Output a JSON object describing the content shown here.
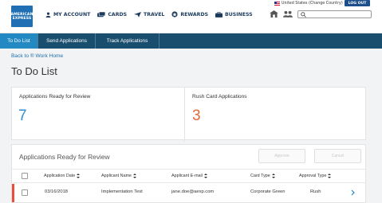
{
  "header": {
    "logo_lines": [
      "AMERICAN",
      "EXPRESS"
    ],
    "nav": [
      {
        "label": "MY ACCOUNT",
        "icon": "person-icon"
      },
      {
        "label": "CARDS",
        "icon": "cards-icon"
      },
      {
        "label": "TRAVEL",
        "icon": "plane-icon"
      },
      {
        "label": "REWARDS",
        "icon": "rewards-icon"
      },
      {
        "label": "BUSINESS",
        "icon": "briefcase-icon"
      }
    ],
    "country": "United States (Change Country)",
    "logout_label": "LOG OUT",
    "search_placeholder": ""
  },
  "tabs": [
    {
      "label": "To Do List",
      "active": true
    },
    {
      "label": "Send Applications",
      "active": false
    },
    {
      "label": "Track Applications",
      "active": false
    }
  ],
  "breadcrumb": "Back to ® Work Home",
  "page_title": "To Do List",
  "stats": [
    {
      "label": "Applications Ready for Review",
      "value": "7"
    },
    {
      "label": "Rush Card Applications",
      "value": "3"
    }
  ],
  "review": {
    "title": "Applications Ready for Review",
    "approve_label": "Approve",
    "cancel_label": "Cancel",
    "columns": [
      "Application Date",
      "Applicant Name",
      "Applicant E-mail",
      "Card Type",
      "Approval Type"
    ],
    "rows": [
      {
        "date": "03/16/2018",
        "name": "Implementation Test",
        "email": "jane.doe@aexp.com",
        "card_type": "Corporate Green",
        "approval_type": "Rush"
      }
    ]
  },
  "colors": {
    "brand_blue": "#1f6fb5",
    "tab_bar": "#1a4e6e",
    "tab_active": "#2389c2",
    "stat_blue": "#2c8ed8",
    "stat_orange": "#e2693a",
    "row_flag": "#e8503a"
  }
}
